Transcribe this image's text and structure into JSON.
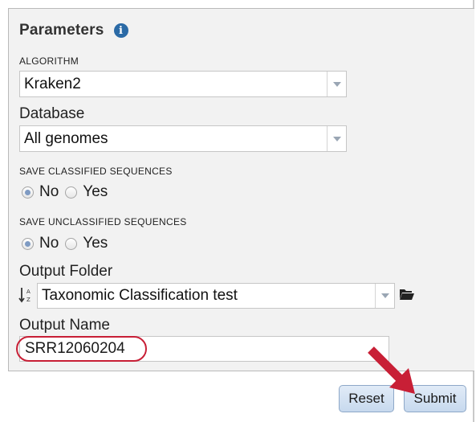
{
  "parameters": {
    "title": "Parameters",
    "info_icon_glyph": "i",
    "algorithm": {
      "label": "ALGORITHM",
      "value": "Kraken2"
    },
    "database": {
      "label": "Database",
      "value": "All genomes"
    },
    "save_classified": {
      "label": "SAVE CLASSIFIED SEQUENCES",
      "options": [
        {
          "label": "No",
          "selected": true
        },
        {
          "label": "Yes",
          "selected": false
        }
      ]
    },
    "save_unclassified": {
      "label": "SAVE UNCLASSIFIED SEQUENCES",
      "options": [
        {
          "label": "No",
          "selected": true
        },
        {
          "label": "Yes",
          "selected": false
        }
      ]
    },
    "output_folder": {
      "label": "Output Folder",
      "value": "Taxonomic Classification test"
    },
    "output_name": {
      "label": "Output Name",
      "value": "SRR12060204"
    }
  },
  "actions": {
    "reset_label": "Reset",
    "submit_label": "Submit"
  },
  "colors": {
    "accent": "#2b6aa6",
    "annotation": "#c81f36",
    "panel_bg": "#f2f2f2",
    "button_bg": "#d3e1f2"
  }
}
